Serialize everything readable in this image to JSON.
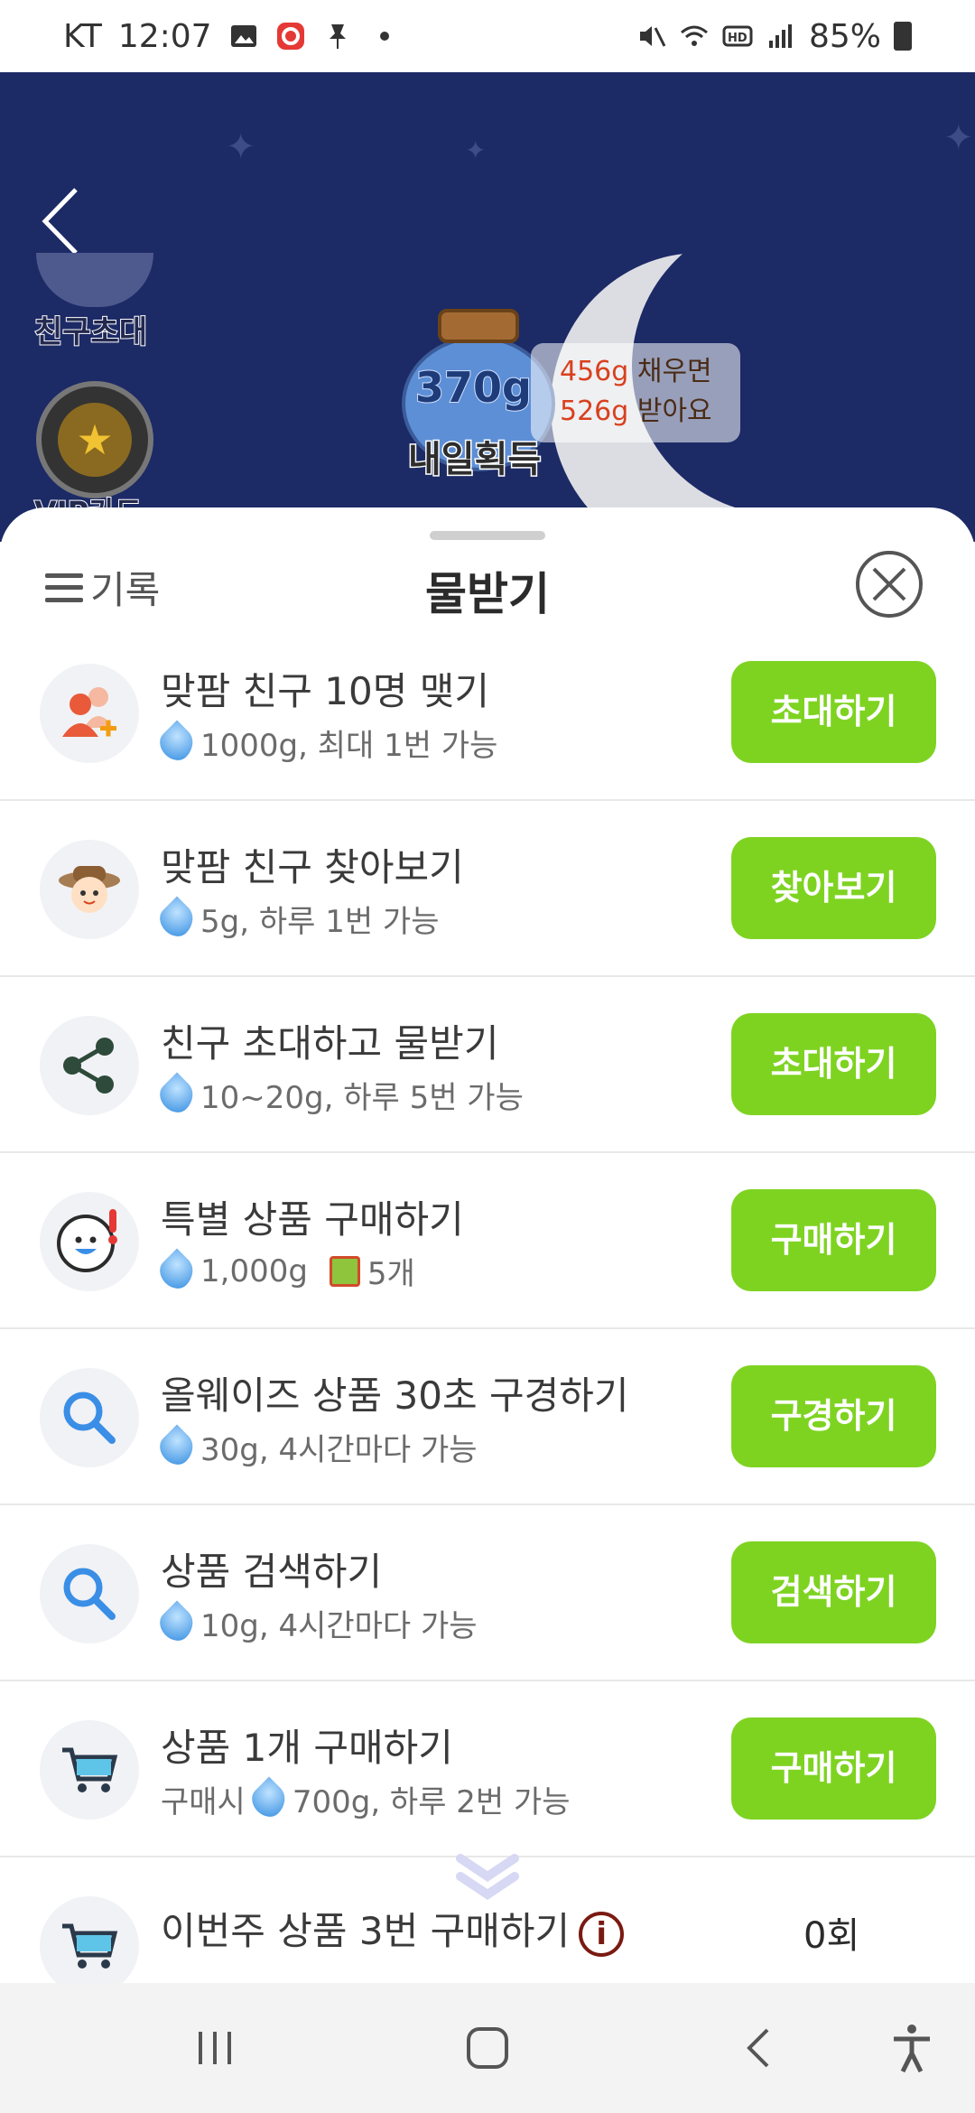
{
  "status_bar": {
    "carrier": "KT",
    "time": "12:07",
    "battery": "85%"
  },
  "hero": {
    "friend_invite_label": "친구초대",
    "vip_label": "VIP카드",
    "jar_amount": "370g",
    "jar_label": "내일획득",
    "bubble_line1_amount": "456g",
    "bubble_line1_text": "채우면",
    "bubble_line2_amount": "526g",
    "bubble_line2_text": "받아요"
  },
  "sheet": {
    "history_label": "기록",
    "title": "물받기"
  },
  "tasks": [
    {
      "icon": "friends-add-icon",
      "title": "맞팜 친구 10명 맺기",
      "reward": "1000g, 최대 1번 가능",
      "button": "초대하기"
    },
    {
      "icon": "farmer-avatar-icon",
      "title": "맞팜 친구 찾아보기",
      "reward": "5g, 하루 1번 가능",
      "button": "찾아보기"
    },
    {
      "icon": "share-icon",
      "title": "친구 초대하고 물받기",
      "reward": "10~20g, 하루 5번 가능",
      "button": "초대하기"
    },
    {
      "icon": "alert-face-icon",
      "title": "특별 상품 구매하기",
      "reward": "1,000g",
      "extra": "5개",
      "button": "구매하기"
    },
    {
      "icon": "search-icon",
      "title": "올웨이즈 상품 30초 구경하기",
      "reward": "30g, 4시간마다 가능",
      "button": "구경하기"
    },
    {
      "icon": "search-icon",
      "title": "상품 검색하기",
      "reward": "10g, 4시간마다 가능",
      "button": "검색하기"
    },
    {
      "icon": "cart-icon",
      "title": "상품 1개 구매하기",
      "prefix": "구매시",
      "reward": "700g, 하루 2번 가능",
      "button": "구매하기"
    },
    {
      "icon": "cart-icon",
      "title": "이번주 상품 3번 구매하기",
      "count": "0회"
    }
  ],
  "colors": {
    "hero_bg": "#1c2a66",
    "button_green": "#7ed321",
    "accent_red": "#d9401e"
  }
}
